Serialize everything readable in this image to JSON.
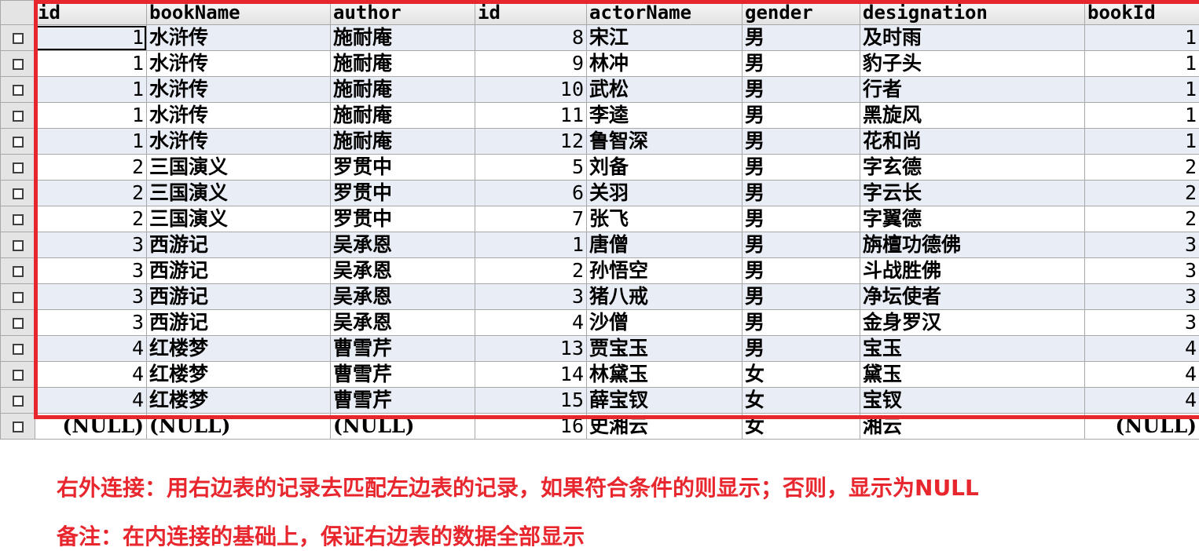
{
  "columns": [
    "id",
    "bookName",
    "author",
    "id",
    "actorName",
    "gender",
    "designation",
    "bookId"
  ],
  "rows": [
    [
      "1",
      "水浒传",
      "施耐庵",
      "8",
      "宋江",
      "男",
      "及时雨",
      "1"
    ],
    [
      "1",
      "水浒传",
      "施耐庵",
      "9",
      "林冲",
      "男",
      "豹子头",
      "1"
    ],
    [
      "1",
      "水浒传",
      "施耐庵",
      "10",
      "武松",
      "男",
      "行者",
      "1"
    ],
    [
      "1",
      "水浒传",
      "施耐庵",
      "11",
      "李逵",
      "男",
      "黑旋风",
      "1"
    ],
    [
      "1",
      "水浒传",
      "施耐庵",
      "12",
      "鲁智深",
      "男",
      "花和尚",
      "1"
    ],
    [
      "2",
      "三国演义",
      "罗贯中",
      "5",
      "刘备",
      "男",
      "字玄德",
      "2"
    ],
    [
      "2",
      "三国演义",
      "罗贯中",
      "6",
      "关羽",
      "男",
      "字云长",
      "2"
    ],
    [
      "2",
      "三国演义",
      "罗贯中",
      "7",
      "张飞",
      "男",
      "字翼德",
      "2"
    ],
    [
      "3",
      "西游记",
      "吴承恩",
      "1",
      "唐僧",
      "男",
      "旃檀功德佛",
      "3"
    ],
    [
      "3",
      "西游记",
      "吴承恩",
      "2",
      "孙悟空",
      "男",
      "斗战胜佛",
      "3"
    ],
    [
      "3",
      "西游记",
      "吴承恩",
      "3",
      "猪八戒",
      "男",
      "净坛使者",
      "3"
    ],
    [
      "3",
      "西游记",
      "吴承恩",
      "4",
      "沙僧",
      "男",
      "金身罗汉",
      "3"
    ],
    [
      "4",
      "红楼梦",
      "曹雪芹",
      "13",
      "贾宝玉",
      "男",
      "宝玉",
      "4"
    ],
    [
      "4",
      "红楼梦",
      "曹雪芹",
      "14",
      "林黛玉",
      "女",
      "黛玉",
      "4"
    ],
    [
      "4",
      "红楼梦",
      "曹雪芹",
      "15",
      "薛宝钗",
      "女",
      "宝钗",
      "4"
    ],
    [
      "(NULL)",
      "(NULL)",
      "(NULL)",
      "16",
      "史湘云",
      "女",
      "湘云",
      "(NULL)"
    ]
  ],
  "annotation": {
    "line1": "右外连接：用右边表的记录去匹配左边表的记录，如果符合条件的则显示；否则，显示为NULL",
    "line2": "备注：在内连接的基础上，保证右边表的数据全部显示"
  },
  "colors": {
    "highlight": "#e8262e",
    "note_text": "#e8262e",
    "row_alt": "#e9edf5"
  }
}
